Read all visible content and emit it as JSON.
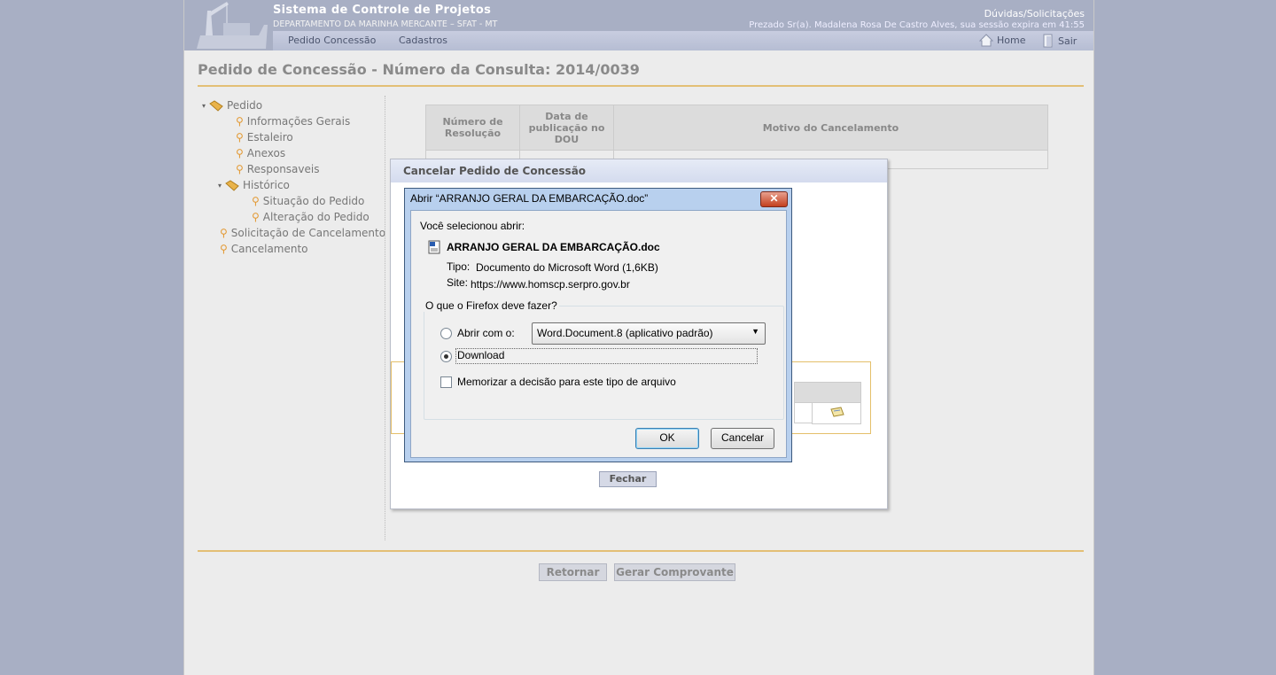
{
  "header": {
    "title": "Sistema de Controle de Projetos",
    "department": "DEPARTAMENTO DA MARINHA MERCANTE – SFAT - MT",
    "help_link": "Dúvidas/Solicitações",
    "session_text": "Prezado Sr(a). Madalena Rosa De Castro Alves, sua sessão expira em 41:55",
    "nav": [
      "Pedido Concessão",
      "Cadastros"
    ],
    "home_label": "Home",
    "logout_label": "Sair"
  },
  "page": {
    "title": "Pedido de Concessão - Número da Consulta: 2014/0039"
  },
  "tree": {
    "root": "Pedido",
    "children": [
      "Informações Gerais",
      "Estaleiro",
      "Anexos",
      "Responsaveis"
    ],
    "historico": "Histórico",
    "historico_children": [
      "Situação do Pedido",
      "Alteração do Pedido"
    ],
    "extra": [
      "Solicitação de Cancelamento",
      "Cancelamento"
    ]
  },
  "resolution_table": {
    "headers": [
      "Número de Resolução",
      "Data de publicação no DOU",
      "Motivo do Cancelamento"
    ]
  },
  "footer_buttons": {
    "back": "Retornar",
    "generate": "Gerar Comprovante"
  },
  "cancel_modal": {
    "title": "Cancelar Pedido de Concessão",
    "close_button": "Fechar"
  },
  "download_dialog": {
    "title": "Abrir “ARRANJO GERAL DA EMBARCAÇÃO.doc”",
    "close_symbol": "✕",
    "selected_label": "Você selecionou abrir:",
    "filename": "ARRANJO GERAL DA EMBARCAÇÃO.doc",
    "type_label": "Tipo:",
    "type_value": "Documento do Microsoft Word  (1,6KB)",
    "site_label": "Site:",
    "site_value": "https://www.homscp.serpro.gov.br",
    "question": "O que o Firefox deve fazer?",
    "open_with_label": "Abrir com o:",
    "open_with_value": "Word.Document.8 (aplicativo padrão)",
    "download_label": "Download",
    "remember_label": "Memorizar a decisão para este tipo de arquivo",
    "ok_button": "OK",
    "cancel_button": "Cancelar",
    "selected_option": "Download",
    "remember_checked": false
  }
}
